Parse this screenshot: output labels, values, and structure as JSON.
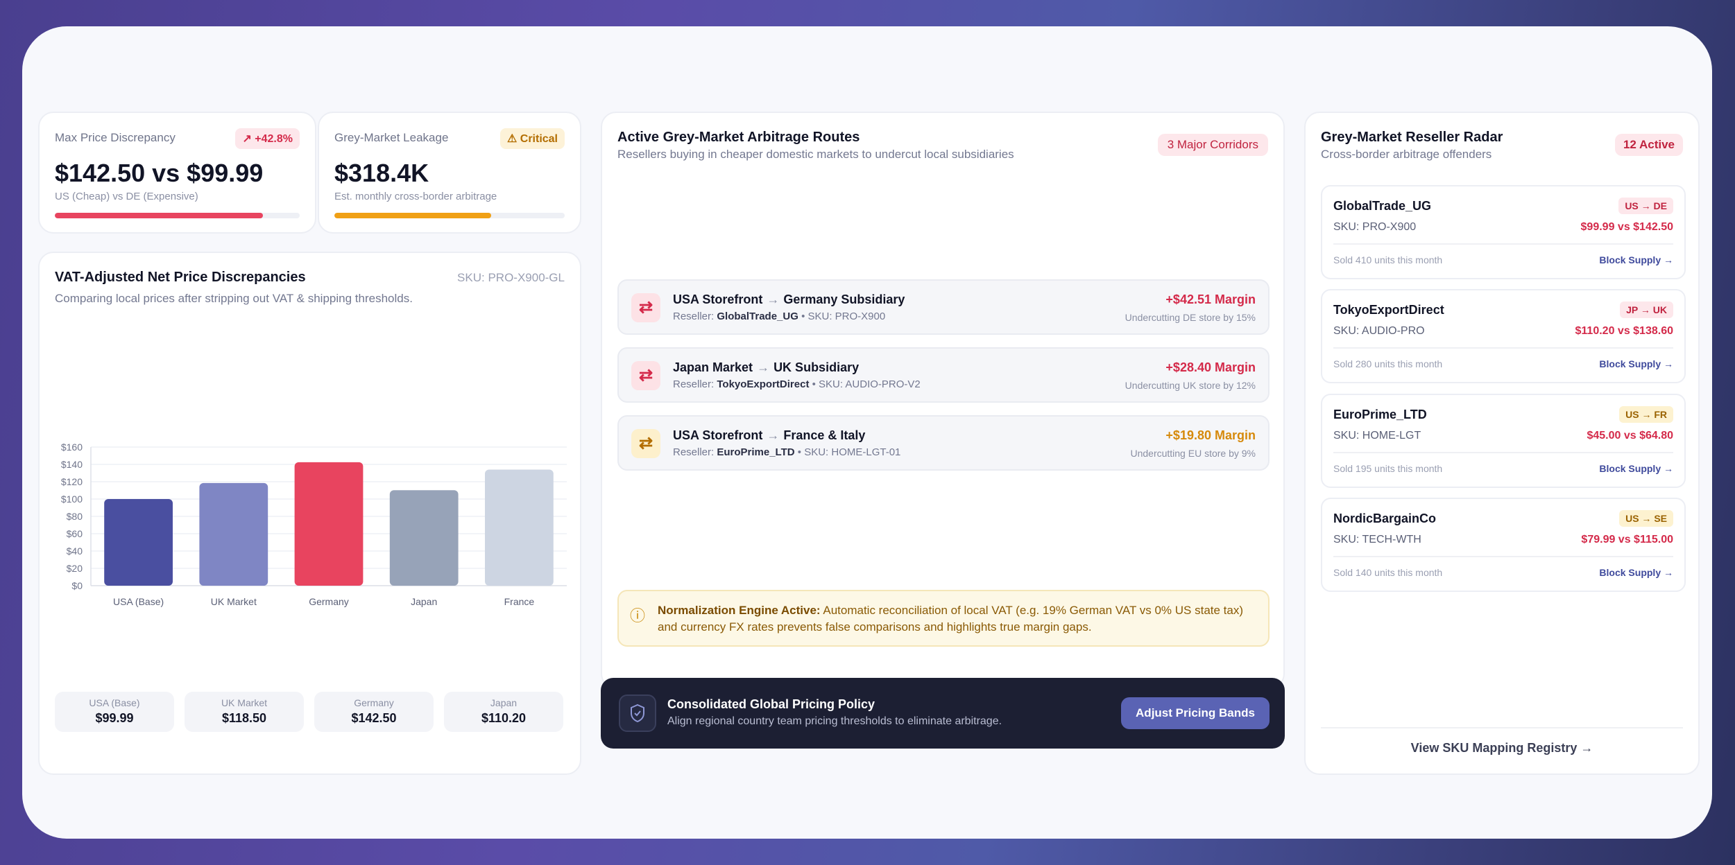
{
  "kpis": [
    {
      "label": "Max Price Discrepancy",
      "badge": "↗ +42.8%",
      "value": "$142.50 vs $99.99",
      "sub": "US (Cheap) vs DE (Expensive)",
      "progress": 0.85,
      "color": "#e8445f"
    },
    {
      "label": "Grey-Market Leakage",
      "badge": "⚠ Critical",
      "value": "$318.4K",
      "sub": "Est. monthly cross-border arbitrage",
      "progress": 0.68,
      "color": "#f0a015"
    }
  ],
  "vat_chart": {
    "title": "VAT-Adjusted Net Price Discrepancies",
    "sku": "SKU: PRO-X900-GL",
    "subtitle": "Comparing local prices after stripping out VAT & shipping thresholds."
  },
  "chart_data": {
    "type": "bar",
    "categories": [
      "USA (Base)",
      "UK Market",
      "Germany",
      "Japan",
      "France"
    ],
    "values": [
      99.99,
      118.5,
      142.5,
      110.2,
      134
    ],
    "colors": [
      "#4a4fa0",
      "#7f86c4",
      "#e8445f",
      "#97a3b8",
      "#cdd5e2"
    ],
    "ylim": [
      0,
      160
    ],
    "yticks": [
      "$0",
      "$20",
      "$40",
      "$60",
      "$80",
      "$100",
      "$120",
      "$140",
      "$160"
    ],
    "grid": true
  },
  "tiles": [
    {
      "label": "USA (Base)",
      "value": "$99.99"
    },
    {
      "label": "UK Market",
      "value": "$118.50"
    },
    {
      "label": "Germany",
      "value": "$142.50"
    },
    {
      "label": "Japan",
      "value": "$110.20"
    }
  ],
  "routes_card": {
    "title": "Active Grey-Market Arbitrage Routes",
    "subtitle": "Resellers buying in cheaper domestic markets to undercut local subsidiaries",
    "badge": "3 Major Corridors"
  },
  "routes": [
    {
      "from": "USA Storefront",
      "arrow": "→",
      "to": "Germany Subsidiary",
      "reseller_label": "Reseller:",
      "reseller": "GlobalTrade_UG",
      "sku": "• SKU: PRO-X900",
      "margin": "+$42.51 Margin",
      "note": "Undercutting DE store by 15%",
      "color": "#d42a4a",
      "icon": "⇄"
    },
    {
      "from": "Japan Market",
      "arrow": "→",
      "to": "UK Subsidiary",
      "reseller_label": "Reseller:",
      "reseller": "TokyoExportDirect",
      "sku": "• SKU: AUDIO-PRO-V2",
      "margin": "+$28.40 Margin",
      "note": "Undercutting UK store by 12%",
      "color": "#d42a4a",
      "icon": "⇄"
    },
    {
      "from": "USA Storefront",
      "arrow": "→",
      "to": "France & Italy",
      "reseller_label": "Reseller:",
      "reseller": "EuroPrime_LTD",
      "sku": "• SKU: HOME-LGT-01",
      "margin": "+$19.80 Margin",
      "note": "Undercutting EU store by 9%",
      "color": "#d68a0c",
      "icon": "⇄"
    }
  ],
  "notice": {
    "icon": "ⓘ",
    "title": "Normalization Engine Active:",
    "text": "Automatic reconciliation of local VAT (e.g. 19% German VAT vs 0% US state tax) and currency FX rates prevents false comparisons and highlights true margin gaps."
  },
  "policy": {
    "icon": "shield-check",
    "title": "Consolidated Global Pricing Policy",
    "subtitle": "Align regional country team pricing thresholds to eliminate arbitrage.",
    "button": "Adjust Pricing Bands"
  },
  "radar": {
    "title": "Grey-Market Reseller Radar",
    "subtitle": "Cross-border arbitrage offenders",
    "badge": "12 Active",
    "footer_link": "View SKU Mapping Registry →"
  },
  "resellers": [
    {
      "name": "GlobalTrade_UG",
      "pair": "US → DE",
      "pair_style": "red",
      "sku": "SKU: PRO-X900",
      "price": "$99.99 vs $142.50",
      "sold": "Sold 410 units this month",
      "action": "Block Supply →"
    },
    {
      "name": "TokyoExportDirect",
      "pair": "JP → UK",
      "pair_style": "red",
      "sku": "SKU: AUDIO-PRO",
      "price": "$110.20 vs $138.60",
      "sold": "Sold 280 units this month",
      "action": "Block Supply →"
    },
    {
      "name": "EuroPrime_LTD",
      "pair": "US → FR",
      "pair_style": "amber",
      "sku": "SKU: HOME-LGT",
      "price": "$45.00 vs $64.80",
      "sold": "Sold 195 units this month",
      "action": "Block Supply →"
    },
    {
      "name": "NordicBargainCo",
      "pair": "US → SE",
      "pair_style": "amber",
      "sku": "SKU: TECH-WTH",
      "price": "$79.99 vs $115.00",
      "sold": "Sold 140 units this month",
      "action": "Block Supply →"
    }
  ]
}
